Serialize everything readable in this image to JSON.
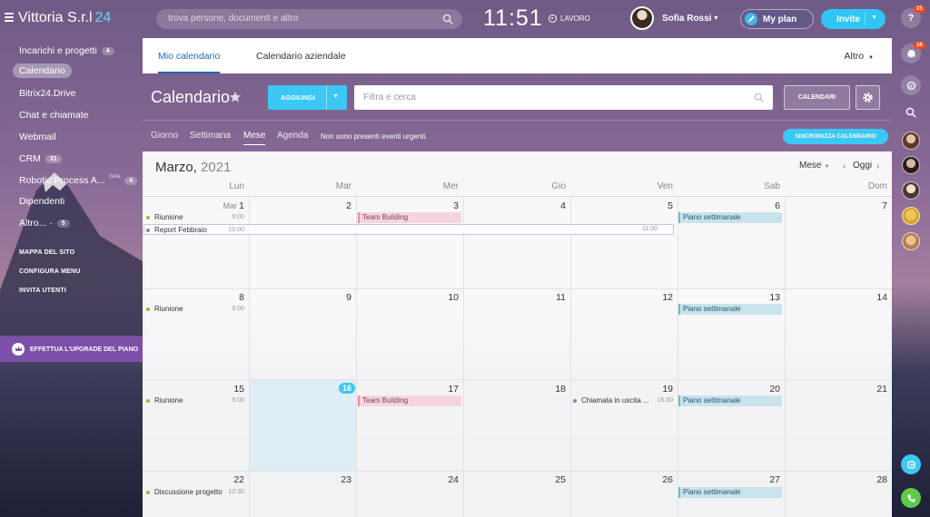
{
  "header": {
    "company": "Vittoria S.r.l",
    "company_num": "24",
    "search_placeholder": "trova persone, documenti e altro",
    "clock": "11:51",
    "work_status": "LAVORO",
    "user_name": "Sofia Rossi",
    "my_plan": "My plan",
    "invite": "Invite"
  },
  "sidebar": {
    "items": [
      {
        "label": "Incarichi e progetti",
        "count": "4"
      },
      {
        "label": "Calendario"
      },
      {
        "label": "Bitrix24.Drive"
      },
      {
        "label": "Chat e chiamate"
      },
      {
        "label": "Webmail"
      },
      {
        "label": "CRM",
        "count": "31"
      },
      {
        "label": "Robotic Process A...",
        "beta": "beta",
        "count": "4"
      },
      {
        "label": "Dipendenti"
      },
      {
        "label": "Altro... ·",
        "count": "5"
      }
    ],
    "links": [
      "MAPPA DEL SITO",
      "CONFIGURA MENU",
      "INVITA UTENTI"
    ],
    "upgrade": "EFFETTUA L'UPGRADE DEL PIANO"
  },
  "rightrail": {
    "help": "?",
    "notif_badge": "15",
    "notif2_badge": "16"
  },
  "tabs": {
    "my_calendar": "Mio calendario",
    "company_calendar": "Calendario aziendale",
    "more": "Altro"
  },
  "toolbar": {
    "title": "Calendario",
    "add": "AGGIUNGI",
    "filter_placeholder": "Filtra e cerca",
    "calendars": "CALENDARI",
    "sync": "SINCRONIZZA CALENDARIO"
  },
  "views": {
    "day": "Giorno",
    "week": "Settimana",
    "month": "Mese",
    "agenda": "Agenda",
    "urgent_note": "Non sono presenti eventi urgenti."
  },
  "calendar": {
    "month": "Marzo,",
    "year": "2021",
    "view_selector": "Mese",
    "today_btn": "Oggi",
    "days_of_week": [
      "Lun",
      "Mar",
      "Mer",
      "Gio",
      "Ven",
      "Sab",
      "Dom"
    ],
    "first_day_month": "Mar",
    "weeks": [
      [
        "1",
        "2",
        "3",
        "4",
        "5",
        "6",
        "7"
      ],
      [
        "8",
        "9",
        "10",
        "11",
        "12",
        "13",
        "14"
      ],
      [
        "15",
        "16",
        "17",
        "18",
        "19",
        "20",
        "21"
      ],
      [
        "22",
        "23",
        "24",
        "25",
        "26",
        "27",
        "28"
      ]
    ],
    "today": "16",
    "events": {
      "riunione": "Riunione",
      "riunione_time": "9:00",
      "report": "Report Febbraio",
      "report_start": "10:00",
      "report_end": "11:00",
      "team_building": "Team Building",
      "piano": "Piano settimanale",
      "chiamata": "Chiamata in uscita ...",
      "chiamata_time": "16:30",
      "discussione": "Discussione progetto",
      "discussione_time": "12:30"
    },
    "colors": {
      "green_dot": "#9dbb28",
      "purple_dot": "#8a7fc0"
    }
  }
}
